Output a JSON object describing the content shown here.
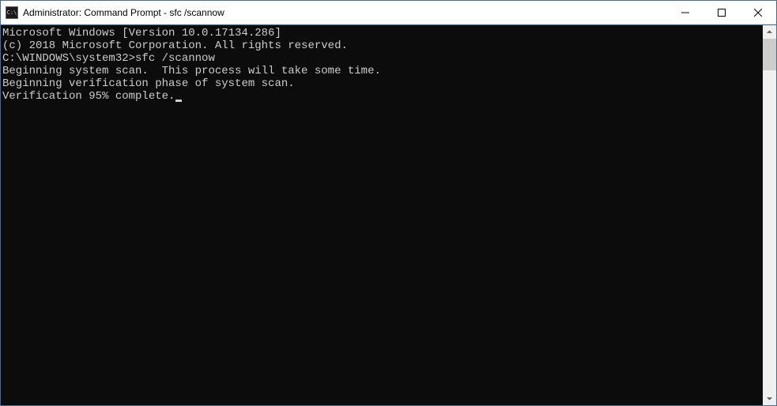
{
  "window": {
    "title": "Administrator: Command Prompt - sfc  /scannow"
  },
  "terminal": {
    "line1": "Microsoft Windows [Version 10.0.17134.286]",
    "line2": "(c) 2018 Microsoft Corporation. All rights reserved.",
    "line3": "",
    "line4": "C:\\WINDOWS\\system32>sfc /scannow",
    "line5": "",
    "line6": "Beginning system scan.  This process will take some time.",
    "line7": "",
    "line8": "Beginning verification phase of system scan.",
    "line9": "Verification 95% complete."
  }
}
